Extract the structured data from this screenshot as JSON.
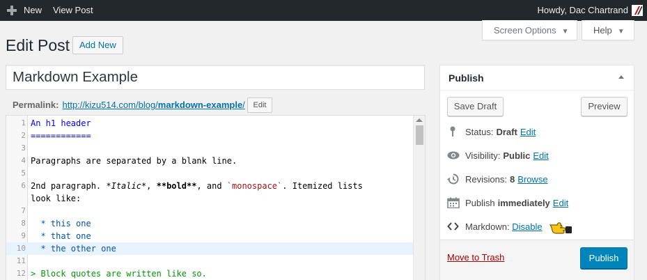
{
  "adminbar": {
    "new_label": "New",
    "view_post_label": "View Post",
    "howdy": "Howdy, Dac Chartrand"
  },
  "screen_meta": {
    "screen_options": "Screen Options",
    "help": "Help"
  },
  "page": {
    "title": "Edit Post",
    "add_new": "Add New"
  },
  "post": {
    "title": "Markdown Example",
    "permalink_label": "Permalink:",
    "permalink_base": "http://kizu514.com/blog/",
    "permalink_slug": "markdown-example",
    "permalink_trailing": "/",
    "permalink_edit": "Edit"
  },
  "editor": {
    "lines": [
      {
        "n": "1",
        "text": "An h1 header"
      },
      {
        "n": "2",
        "text": "============"
      },
      {
        "n": "3",
        "text": ""
      },
      {
        "n": "4",
        "text": "Paragraphs are separated by a blank line."
      },
      {
        "n": "5",
        "text": ""
      },
      {
        "n": "6",
        "text_a": "2nd paragraph. ",
        "text_b": "*Italic*",
        "text_c": ", ",
        "text_d": "**bold**",
        "text_e": ", and ",
        "text_f": "`monospace`",
        "text_g": ". Itemized lists"
      },
      {
        "n": "",
        "text": "look like:"
      },
      {
        "n": "7",
        "text": ""
      },
      {
        "n": "8",
        "text": "  * this one"
      },
      {
        "n": "9",
        "text": "  * that one"
      },
      {
        "n": "10",
        "text": "  * the other one"
      },
      {
        "n": "11",
        "text": ""
      },
      {
        "n": "12",
        "text": "> Block quotes are written like so."
      }
    ]
  },
  "publish": {
    "title": "Publish",
    "save_draft": "Save Draft",
    "preview": "Preview",
    "status_label": "Status:",
    "status_value": "Draft",
    "status_edit": "Edit",
    "visibility_label": "Visibility:",
    "visibility_value": "Public",
    "visibility_edit": "Edit",
    "revisions_label": "Revisions:",
    "revisions_value": "8",
    "revisions_browse": "Browse",
    "publish_label": "Publish",
    "publish_value": "immediately",
    "publish_edit": "Edit",
    "markdown_label": "Markdown:",
    "markdown_disable": "Disable",
    "move_to_trash": "Move to Trash",
    "publish_button": "Publish"
  },
  "colors": {
    "adminbar": "#23282d",
    "link": "#0073aa",
    "primary_button": "#0085ba",
    "trash": "#a00",
    "active_line": "#e8f2fe"
  }
}
